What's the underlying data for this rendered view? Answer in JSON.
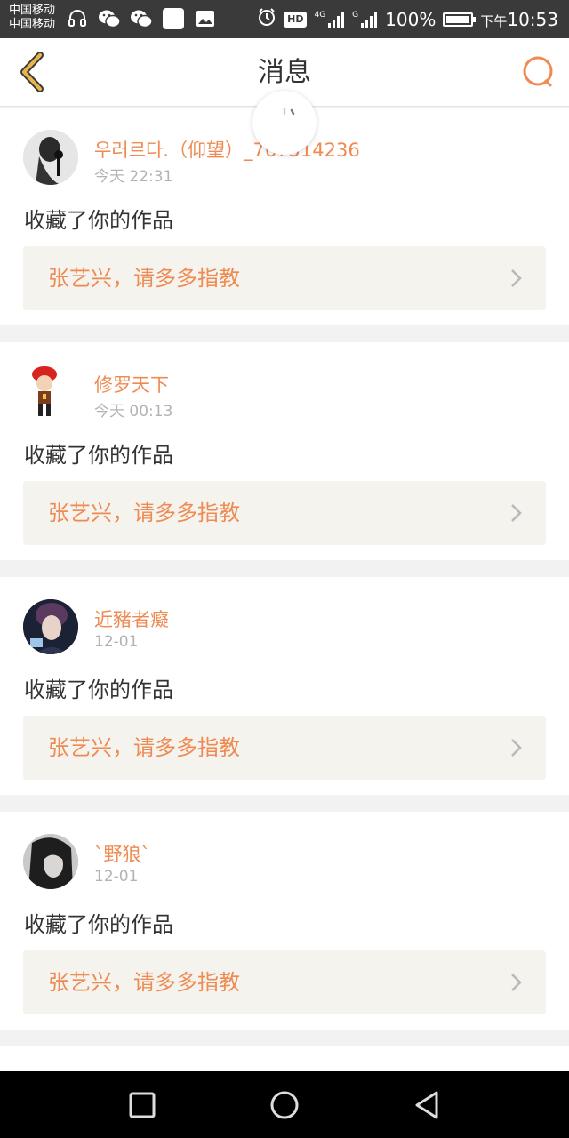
{
  "status_bar": {
    "carrier_1": "中国移动",
    "carrier_2": "中国移动",
    "battery": "100%",
    "ampm": "下午",
    "time": "10:53",
    "network_4g": "4G",
    "network_g": "G",
    "hd": "HD"
  },
  "header": {
    "title": "消息",
    "accent_color": "#ef8a52"
  },
  "messages": [
    {
      "user": "우러르다.（仰望）_767514236",
      "time": "今天 22:31",
      "action": "收藏了你的作品",
      "work": "张艺兴，请多多指教"
    },
    {
      "user": "修罗天下",
      "time": "今天 00:13",
      "action": "收藏了你的作品",
      "work": "张艺兴，请多多指教"
    },
    {
      "user": "近豬者癡",
      "time": "12-01",
      "action": "收藏了你的作品",
      "work": "张艺兴，请多多指教"
    },
    {
      "user": "`野狼`",
      "time": "12-01",
      "action": "收藏了你的作品",
      "work": "张艺兴，请多多指教"
    }
  ]
}
